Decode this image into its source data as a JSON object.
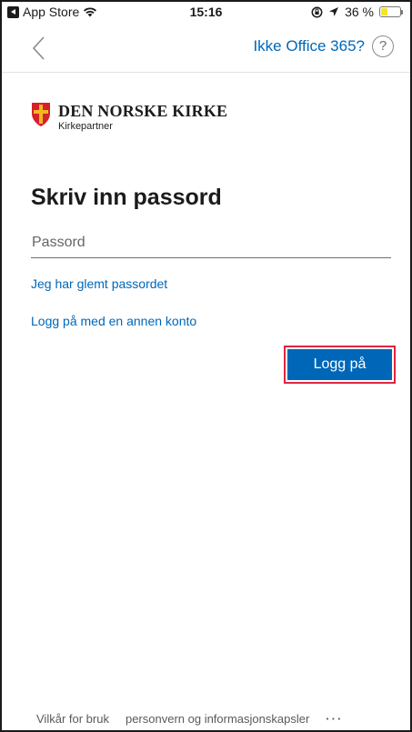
{
  "status_bar": {
    "back_app": "App Store",
    "time": "15:16",
    "battery_text": "36 %",
    "battery_level": 0.36,
    "battery_color": "#f5e52a"
  },
  "nav": {
    "link_label": "Ikke Office 365?",
    "help_symbol": "?"
  },
  "logo": {
    "name": "DEN NORSKE KIRKE",
    "subtitle": "Kirkepartner"
  },
  "page": {
    "title": "Skriv inn passord",
    "password_placeholder": "Passord",
    "forgot_link": "Jeg har glemt passordet",
    "other_account_link": "Logg på med en annen konto",
    "signin_label": "Logg på"
  },
  "footer": {
    "terms": "Vilkår for bruk",
    "privacy": "personvern og informasjonskapsler",
    "more": "···"
  },
  "colors": {
    "accent": "#0067b8",
    "highlight": "#e0263f"
  }
}
